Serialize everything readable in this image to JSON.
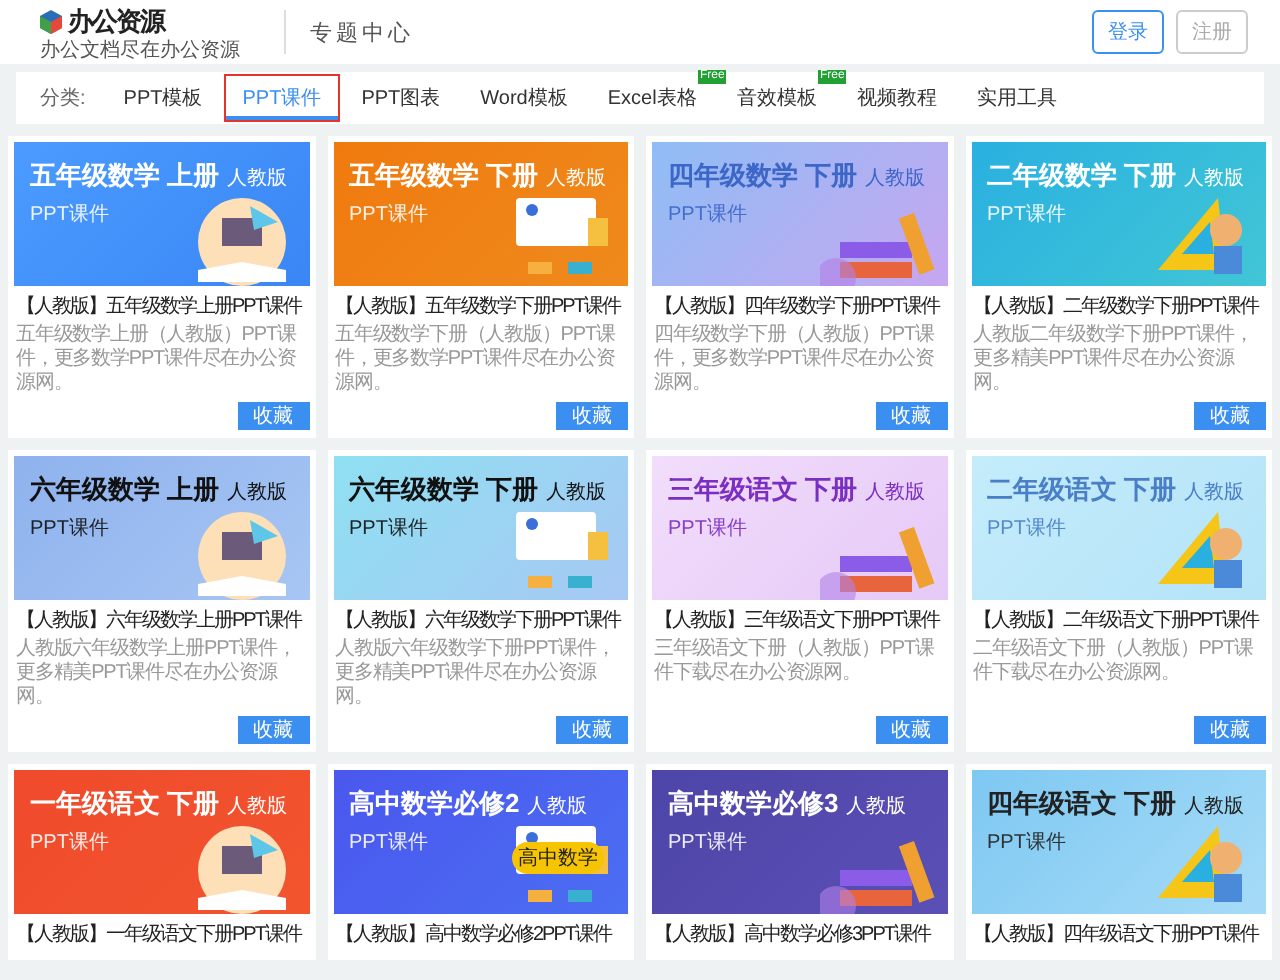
{
  "header": {
    "logo": {
      "name": "办公资源",
      "tagline": "办公文档尽在办公资源"
    },
    "section": "专题中心",
    "buttons": [
      {
        "label": "登录",
        "disabled": false
      },
      {
        "label": "注册",
        "disabled": true
      }
    ]
  },
  "categories": {
    "label": "分类:",
    "tabs": [
      {
        "label": "PPT模板",
        "selected": false,
        "highlighted": false
      },
      {
        "label": "PPT课件",
        "selected": true,
        "highlighted": true
      },
      {
        "label": "PPT图表",
        "selected": false,
        "highlighted": false
      },
      {
        "label": "Word模板",
        "selected": false,
        "highlighted": false
      },
      {
        "label": "Excel表格",
        "selected": false,
        "highlighted": false,
        "badge": "Free"
      },
      {
        "label": "音效模板",
        "selected": false,
        "highlighted": false,
        "badge": "Free"
      },
      {
        "label": "视频教程",
        "selected": false,
        "highlighted": false
      },
      {
        "label": "实用工具",
        "selected": false,
        "highlighted": false
      }
    ]
  },
  "cards": [
    {
      "banner": {
        "title": "五年级数学 上册",
        "edition": "人教版",
        "subtitle": "PPT课件"
      },
      "title": "【人教版】五年级数学上册PPT课件",
      "desc": "五年级数学上册（人教版）PPT课件，更多数学PPT课件尽在办公资源网。",
      "button": "收藏"
    },
    {
      "banner": {
        "title": "五年级数学 下册",
        "edition": "人教版",
        "subtitle": "PPT课件"
      },
      "title": "【人教版】五年级数学下册PPT课件",
      "desc": "五年级数学下册（人教版）PPT课件，更多数学PPT课件尽在办公资源网。",
      "button": "收藏"
    },
    {
      "banner": {
        "title": "四年级数学 下册",
        "edition": "人教版",
        "subtitle": "PPT课件"
      },
      "title": "【人教版】四年级数学下册PPT课件",
      "desc": "四年级数学下册（人教版）PPT课件，更多数学PPT课件尽在办公资源网。",
      "button": "收藏"
    },
    {
      "banner": {
        "title": "二年级数学 下册",
        "edition": "人教版",
        "subtitle": "PPT课件"
      },
      "title": "【人教版】二年级数学下册PPT课件",
      "desc": "人教版二年级数学下册PPT课件，更多精美PPT课件尽在办公资源网。",
      "button": "收藏"
    },
    {
      "banner": {
        "title": "六年级数学 上册",
        "edition": "人教版",
        "subtitle": "PPT课件"
      },
      "title": "【人教版】六年级数学上册PPT课件",
      "desc": "人教版六年级数学上册PPT课件，更多精美PPT课件尽在办公资源网。",
      "button": "收藏"
    },
    {
      "banner": {
        "title": "六年级数学 下册",
        "edition": "人教版",
        "subtitle": "PPT课件"
      },
      "title": "【人教版】六年级数学下册PPT课件",
      "desc": "人教版六年级数学下册PPT课件，更多精美PPT课件尽在办公资源网。",
      "button": "收藏"
    },
    {
      "banner": {
        "title": "三年级语文 下册",
        "edition": "人教版",
        "subtitle": "PPT课件"
      },
      "title": "【人教版】三年级语文下册PPT课件",
      "desc": "三年级语文下册（人教版）PPT课件下载尽在办公资源网。",
      "button": "收藏"
    },
    {
      "banner": {
        "title": "二年级语文 下册",
        "edition": "人教版",
        "subtitle": "PPT课件"
      },
      "title": "【人教版】二年级语文下册PPT课件",
      "desc": "二年级语文下册（人教版）PPT课件下载尽在办公资源网。",
      "button": "收藏"
    },
    {
      "banner": {
        "title": "一年级语文 下册",
        "edition": "人教版",
        "subtitle": "PPT课件"
      },
      "title": "【人教版】一年级语文下册PPT课件"
    },
    {
      "banner": {
        "title": "高中数学必修2",
        "edition": "人教版",
        "subtitle": "PPT课件",
        "sticker": "高中数学"
      },
      "title": "【人教版】高中数学必修2PPT课件"
    },
    {
      "banner": {
        "title": "高中数学必修3",
        "edition": "人教版",
        "subtitle": "PPT课件"
      },
      "title": "【人教版】高中数学必修3PPT课件"
    },
    {
      "banner": {
        "title": "四年级语文 下册",
        "edition": "人教版",
        "subtitle": "PPT课件"
      },
      "title": "【人教版】四年级语文下册PPT课件"
    }
  ]
}
